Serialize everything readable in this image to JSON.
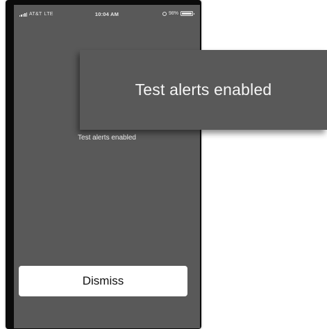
{
  "status_bar": {
    "carrier": "AT&T",
    "network": "LTE",
    "time": "10:04 AM",
    "battery_text": "98%",
    "battery_level": 0.98,
    "icons": [
      "signal-icon",
      "rotation-lock-icon",
      "battery-icon"
    ]
  },
  "screen": {
    "message": "Test alerts enabled",
    "dismiss_label": "Dismiss",
    "background_color": "#595959"
  },
  "callout": {
    "text": "Test alerts enabled"
  }
}
